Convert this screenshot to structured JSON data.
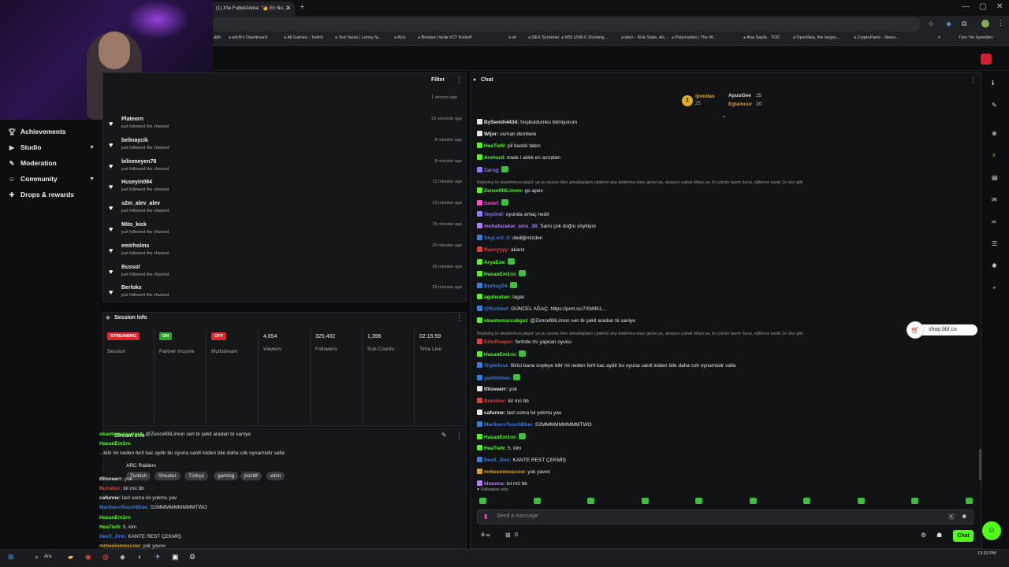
{
  "browser": {
    "active_tab_title": "(1) X'te FutbolArena: \"🧑 En No...",
    "bookmarks": [
      "...ddit",
      "wtcN's Dashboard",
      "All Games - Twitch",
      "Text faces | Lenny fa...",
      "Kick",
      "Browse | kick",
      "VCT Kickoff",
      "vlr",
      "DEX Screener",
      "MSI USB-C Docking...",
      "wtcn - Kick Stats, An...",
      "Polymarket | The W...",
      "Ana Sayfa - TOD",
      "OpenSea, the larges...",
      "CryptoPanic - News..."
    ],
    "all_bookmarks": "Tüm Yer İşaretleri"
  },
  "sidebar": {
    "items": [
      {
        "label": "Achievements",
        "icon": "trophy-icon"
      },
      {
        "label": "Studio",
        "icon": "video-icon"
      },
      {
        "label": "Moderation",
        "icon": "wrench-icon"
      },
      {
        "label": "Community",
        "icon": "users-icon"
      },
      {
        "label": "Drops & rewards",
        "icon": "gift-icon"
      }
    ]
  },
  "activity": {
    "filter_label": "Filter",
    "first_time": "1 second ago",
    "rows": [
      {
        "name": "Plateorn",
        "sub": "just followed the channel",
        "time": "16 seconds ago"
      },
      {
        "name": "belinaycik",
        "sub": "just followed the channel",
        "time": "8 minutes ago"
      },
      {
        "name": "bilinmeyen78",
        "sub": "just followed the channel",
        "time": "8 minutes ago"
      },
      {
        "name": "Huseyin094",
        "sub": "just followed the channel",
        "time": "11 minutes ago"
      },
      {
        "name": "s2m_alev_alev",
        "sub": "just followed the channel",
        "time": "13 minutes ago"
      },
      {
        "name": "Mito_kick",
        "sub": "just followed the channel",
        "time": "16 minutes ago"
      },
      {
        "name": "emirholms",
        "sub": "just followed the channel",
        "time": "20 minutes ago"
      },
      {
        "name": "Bussol",
        "sub": "just followed the channel",
        "time": "20 minutes ago"
      },
      {
        "name": "Berloks",
        "sub": "just followed the channel",
        "time": "23 minutes ago"
      }
    ]
  },
  "session": {
    "title": "Session Info",
    "cells": [
      {
        "badge": "STREAMING",
        "label": "Session",
        "color": "#e0262f"
      },
      {
        "badge": "ON",
        "label": "Partner Income",
        "color": "#2aa52a"
      },
      {
        "badge": "OFF",
        "label": "Multistream",
        "color": "#e0262f"
      },
      {
        "value": "4,654",
        "label": "Viewers"
      },
      {
        "value": "325,402",
        "label": "Followers"
      },
      {
        "value": "1,396",
        "label": "Sub Counts"
      },
      {
        "value": "02:15:59",
        "label": "Time Live"
      }
    ]
  },
  "stream_info": {
    "title": "Stream Info",
    "game": "ARC Raiders",
    "tags": [
      "Turkish",
      "Shooter",
      "Türkçe",
      "gaming",
      "pozitif",
      "wtcn"
    ],
    "overlay_lines": [
      {
        "user": "okantomurcukgul:",
        "text": "@ZencefilliLimon sen bi çekil aradan bi saniye",
        "color": "#53fc18"
      },
      {
        "user": "HasanEm1ro",
        "text": "",
        "color": "#53fc18"
      },
      {
        "user": "",
        "text": "...bilir mi neden ferit kac aydir bu oyuna sardi loiden bile daha cok oynamistir valla",
        "color": "#e6e6e6"
      },
      {
        "user": "tfiloveerr:",
        "text": "yok",
        "color": "#e6e6e6"
      },
      {
        "user": "Bunskor:",
        "text": "lül mü bb",
        "color": "#e04040"
      },
      {
        "user": "cafunne:",
        "text": "last sonra loi yokmu yav",
        "color": "#e6e6e6"
      },
      {
        "user": "MarlboroTouchBlue:",
        "text": "S2MMMMMMMMMTWO",
        "color": "#3b7ddd"
      },
      {
        "user": "HasanEm1ro",
        "text": "",
        "color": "#53fc18"
      },
      {
        "user": "HeaTieN:",
        "text": "5. kim",
        "color": "#53fc18"
      },
      {
        "user": "Devil_Jinn:",
        "text": "KANTE REST ÇEKMİŞ",
        "color": "#3b7ddd"
      },
      {
        "user": "mrbeeinmoscow:",
        "text": "yok yavvv",
        "color": "#e0a020"
      },
      {
        "user": "",
        "text": "...mü bb",
        "color": "#e6e6e6"
      }
    ]
  },
  "chat": {
    "title": "Chat",
    "top_chatters": [
      {
        "name": "ijonidas",
        "count": "25"
      },
      {
        "name": "ApuuGee",
        "count": "25"
      },
      {
        "name": "Eglamour",
        "count": "20"
      }
    ],
    "lines": [
      {
        "user": "BySemih4434:",
        "text": "hoşbuldumku bilmiyorum",
        "color": "#e6e6e6"
      },
      {
        "user": "Wijor:",
        "text": "usman dembele",
        "color": "#e6e6e6"
      },
      {
        "user": "HeaTieN:",
        "text": "pil bastık taten",
        "color": "#53fc18"
      },
      {
        "user": "Arxhurd:",
        "text": "trade i aldık en azından",
        "color": "#53fc18"
      },
      {
        "user": "Zarog:",
        "text": "",
        "color": "#8a7dff"
      },
      {
        "reply": "Replying to okantomurcukgul: ya şu oyune ölen arkadaşların çiplerini alıp kaldırma olayı gelse ya, aksiyon çabuk bitiyo ya, bi çözüm lazım buna, eğlence sanki 2x olur gibi"
      },
      {
        "user": "ZencefilliLimon:",
        "text": "go apex",
        "color": "#53fc18"
      },
      {
        "user": "Sedef:",
        "text": "",
        "color": "#ff4fd0"
      },
      {
        "user": "Teyzirel:",
        "text": "oyunda amaç nedir",
        "color": "#8a7dff"
      },
      {
        "user": "muhafazakar_sins_38:",
        "text": "Sami çok doğru söylüyor",
        "color": "#b07dff"
      },
      {
        "user": "SkyLin3_0:",
        "text": "dediğimizden",
        "color": "#3b7ddd"
      },
      {
        "user": "Raevyyyy:",
        "text": "akarız",
        "color": "#e04040"
      },
      {
        "user": "AryaExe:",
        "text": "",
        "color": "#53fc18"
      },
      {
        "user": "HasanEm1ro:",
        "text": "",
        "color": "#53fc18"
      },
      {
        "user": "Burkay24:",
        "text": "",
        "color": "#3b7ddd"
      },
      {
        "user": "agahvatan:",
        "text": "lagac",
        "color": "#53fc18"
      },
      {
        "user": "@Kickbot:",
        "text": "GÜNCEL AĞAÇ: https://prnt.sc/7Xb9I51...",
        "color": "#3b7ddd"
      },
      {
        "user": "okantomurcukgul:",
        "text": "@ZencefilliLimon sen bi çekil aradan bi saniye",
        "color": "#53fc18"
      },
      {
        "reply": "Replying to okantomurcukgul: ya şu oyune ölen arkadaşların çiplerini alıp kaldırma olayı gelse ya, aksiyon çabuk bitiyo ya, bi çözüm lazım buna, eğlence sanki 2x olur gibi"
      },
      {
        "user": "EliteReaper:",
        "text": "fortnite mı yapcan oyunu",
        "color": "#e04040"
      },
      {
        "user": "HasanEm1ro:",
        "text": "",
        "color": "#53fc18"
      },
      {
        "user": "Triplefour:",
        "text": "Birisi bana soyleye bilir mi neden ferit kac aydir bu oyuna sardi loiden bile daha cok oynamistir valla",
        "color": "#3b7ddd"
      },
      {
        "user": "yazilimtwo:",
        "text": "",
        "color": "#3b7ddd"
      },
      {
        "user": "tfiloveerr:",
        "text": "yok",
        "color": "#e6e6e6"
      },
      {
        "user": "Bunskor:",
        "text": "lül mü bb",
        "color": "#e04040"
      },
      {
        "user": "cafunne:",
        "text": "last sonra loi yokmu yav",
        "color": "#e6e6e6"
      },
      {
        "user": "MarlboroTouchBlue:",
        "text": "S2MMMMMMMMMTWO",
        "color": "#3b7ddd"
      },
      {
        "user": "HasanEm1ro:",
        "text": "",
        "color": "#53fc18"
      },
      {
        "user": "HeaTieN:",
        "text": "5. kim",
        "color": "#53fc18"
      },
      {
        "user": "Devil_Jinn:",
        "text": "KANTE REST ÇEKMİŞ",
        "color": "#3b7ddd"
      },
      {
        "user": "mrbeeinmoscow:",
        "text": "yok yavvv",
        "color": "#e0a020"
      },
      {
        "user": "khanma:",
        "text": "lol mü bb",
        "color": "#b07dff"
      }
    ],
    "followers_only": "Followers only",
    "input_placeholder": "Send a message",
    "points": "0",
    "send_label": "Chat"
  },
  "shop_label": "shop.bbl.co",
  "taskbar": {
    "search_label": "Ara",
    "time": "13:33 PM"
  }
}
